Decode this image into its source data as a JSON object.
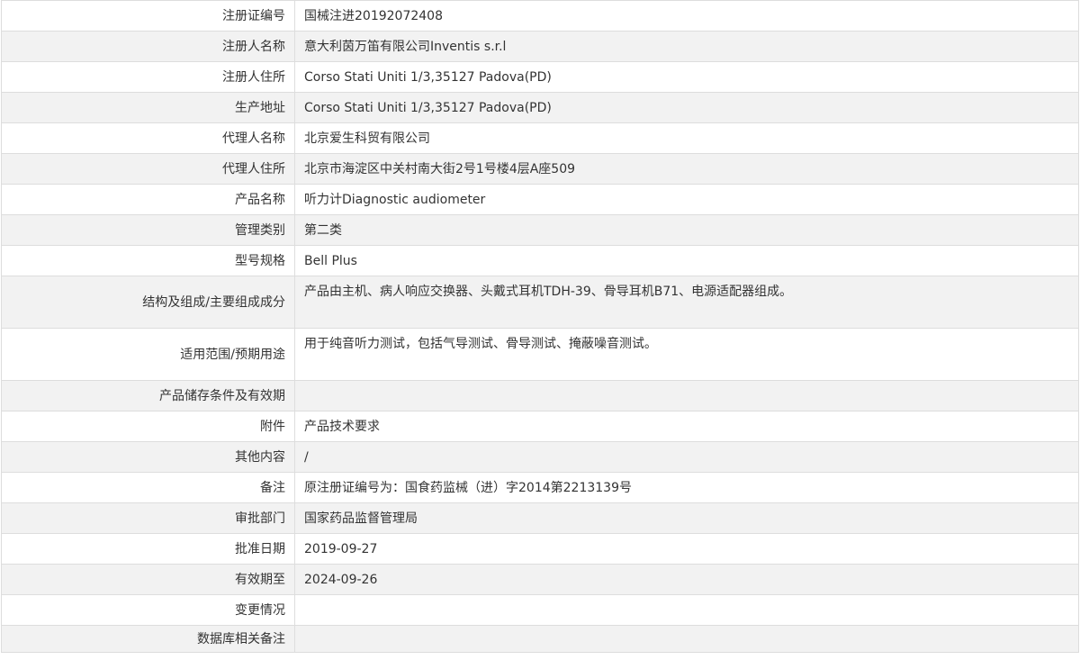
{
  "rows": [
    {
      "label": "注册证编号",
      "value": "国械注进20192072408"
    },
    {
      "label": "注册人名称",
      "value": "意大利茵万笛有限公司Inventis s.r.l"
    },
    {
      "label": "注册人住所",
      "value": "Corso Stati Uniti 1/3,35127 Padova(PD)"
    },
    {
      "label": "生产地址",
      "value": "Corso Stati Uniti 1/3,35127 Padova(PD)"
    },
    {
      "label": "代理人名称",
      "value": "北京爱生科贸有限公司"
    },
    {
      "label": "代理人住所",
      "value": "北京市海淀区中关村南大街2号1号楼4层A座509"
    },
    {
      "label": "产品名称",
      "value": "听力计Diagnostic audiometer"
    },
    {
      "label": "管理类别",
      "value": "第二类"
    },
    {
      "label": "型号规格",
      "value": "Bell Plus"
    },
    {
      "label": "结构及组成/主要组成成分",
      "value": "产品由主机、病人响应交换器、头戴式耳机TDH-39、骨导耳机B71、电源适配器组成。"
    },
    {
      "label": "适用范围/预期用途",
      "value": "用于纯音听力测试，包括气导测试、骨导测试、掩蔽噪音测试。"
    },
    {
      "label": "产品储存条件及有效期",
      "value": ""
    },
    {
      "label": "附件",
      "value": "产品技术要求"
    },
    {
      "label": "其他内容",
      "value": "/"
    },
    {
      "label": "备注",
      "value": "原注册证编号为：国食药监械（进）字2014第2213139号"
    },
    {
      "label": "审批部门",
      "value": "国家药品监督管理局"
    },
    {
      "label": "批准日期",
      "value": "2019-09-27"
    },
    {
      "label": "有效期至",
      "value": "2024-09-26"
    },
    {
      "label": "变更情况",
      "value": ""
    },
    {
      "label": "数据库相关备注",
      "value": ""
    }
  ]
}
